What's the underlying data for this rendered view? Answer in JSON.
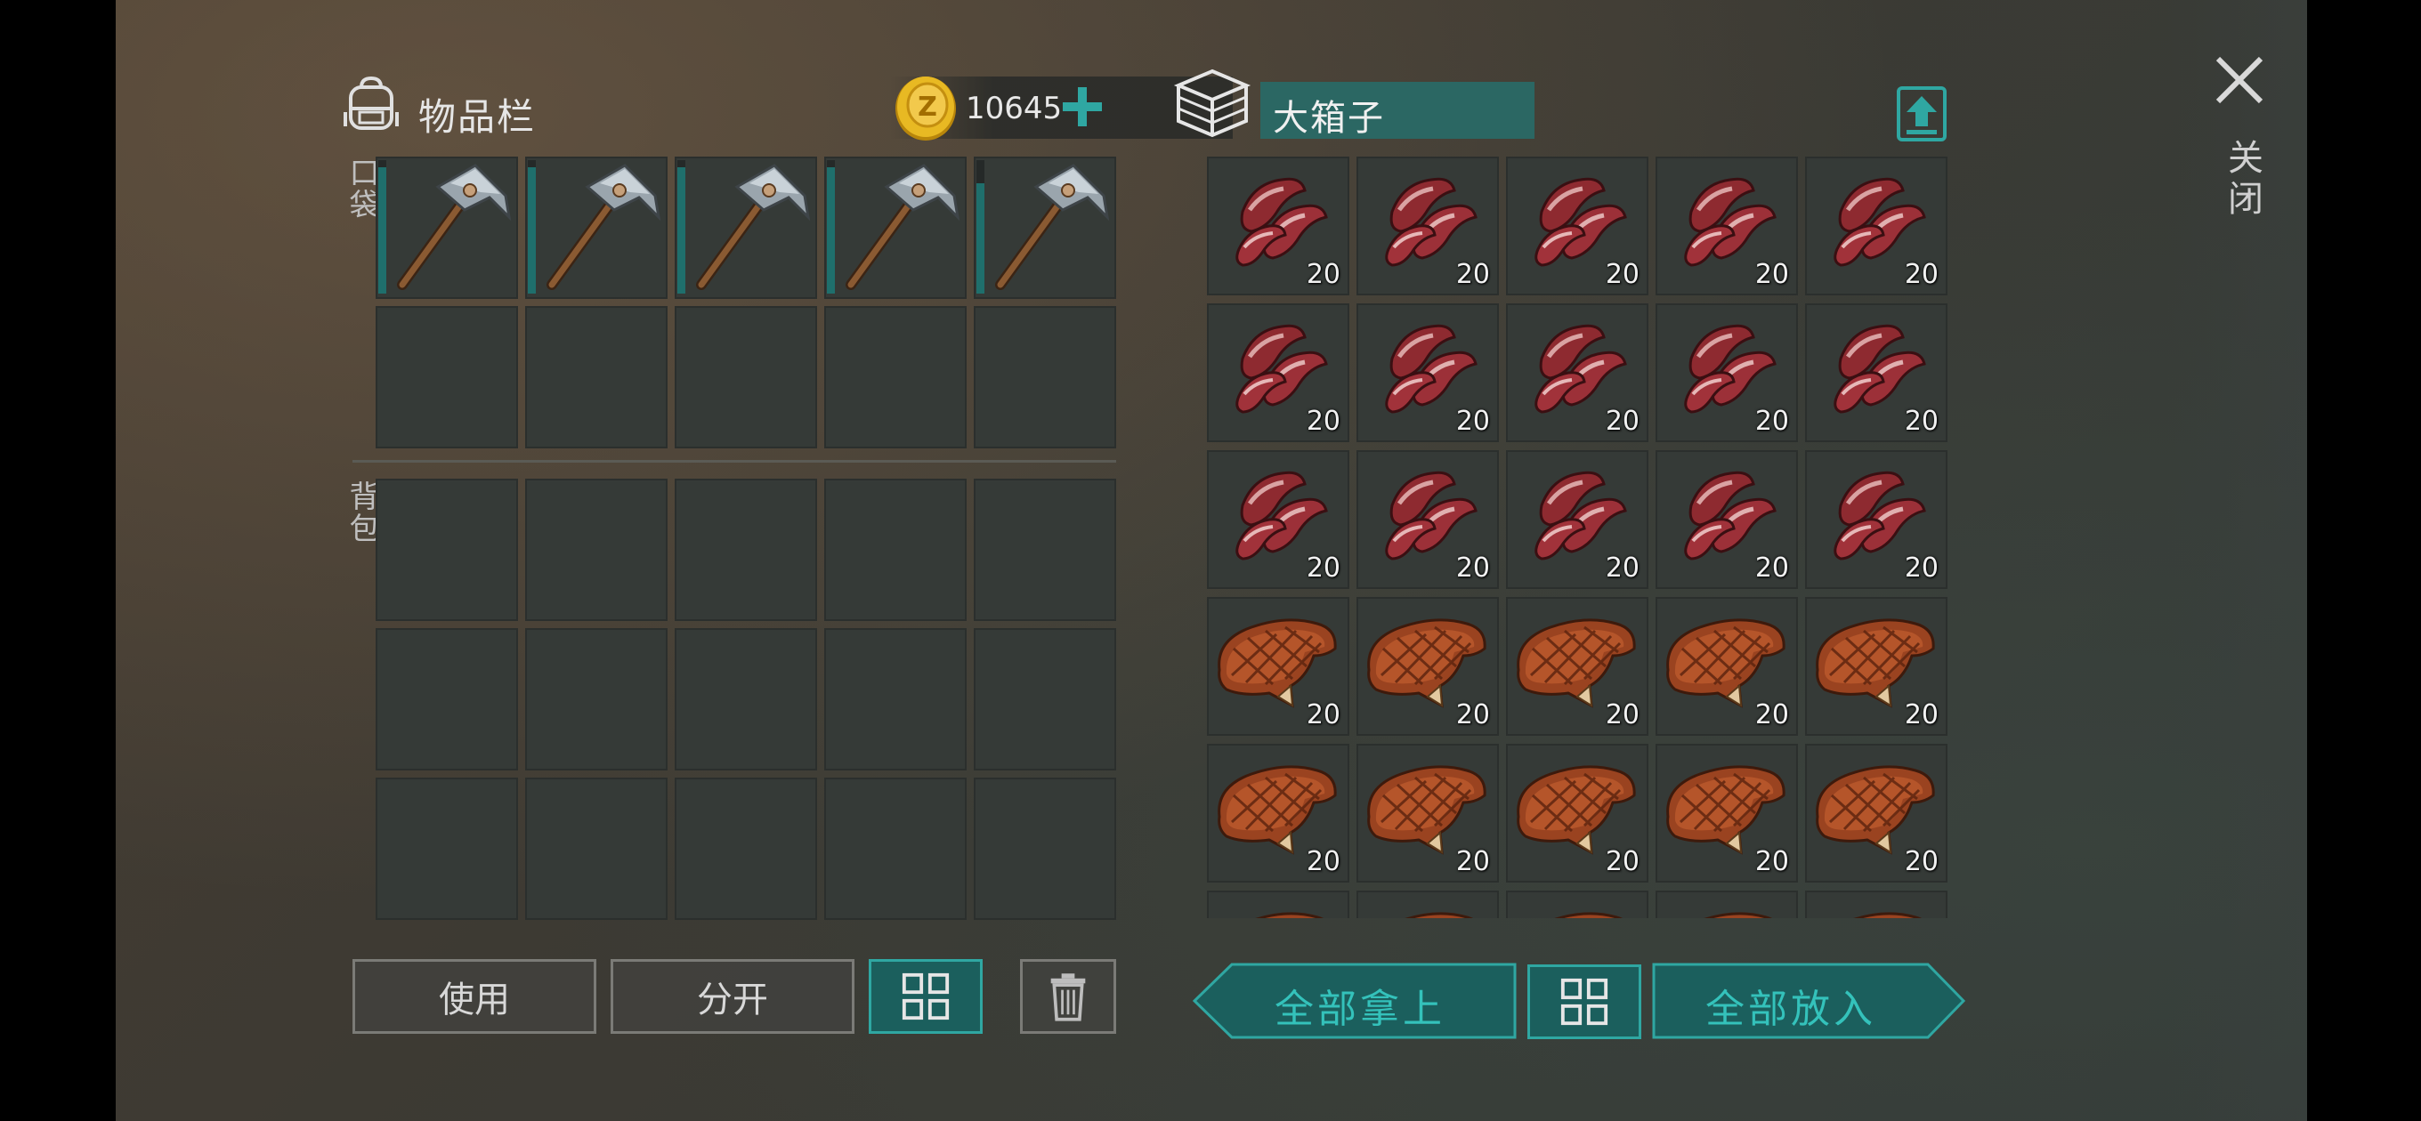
{
  "inventory": {
    "title": "物品栏",
    "coins": "10645",
    "pocket_label": "口袋",
    "backpack_label": "背包",
    "pocket_items": [
      {
        "icon": "hammer-icon",
        "durability": 0.97
      },
      {
        "icon": "hammer-icon",
        "durability": 0.97
      },
      {
        "icon": "hammer-icon",
        "durability": 0.97
      },
      {
        "icon": "hammer-icon",
        "durability": 0.97
      },
      {
        "icon": "hammer-icon",
        "durability": 0.85
      }
    ]
  },
  "container": {
    "title": "大箱子",
    "rows": [
      [
        {
          "icon": "raw-meat-icon",
          "qty": "20"
        },
        {
          "icon": "raw-meat-icon",
          "qty": "20"
        },
        {
          "icon": "raw-meat-icon",
          "qty": "20"
        },
        {
          "icon": "raw-meat-icon",
          "qty": "20"
        },
        {
          "icon": "raw-meat-icon",
          "qty": "20"
        }
      ],
      [
        {
          "icon": "raw-meat-icon",
          "qty": "20"
        },
        {
          "icon": "raw-meat-icon",
          "qty": "20"
        },
        {
          "icon": "raw-meat-icon",
          "qty": "20"
        },
        {
          "icon": "raw-meat-icon",
          "qty": "20"
        },
        {
          "icon": "raw-meat-icon",
          "qty": "20"
        }
      ],
      [
        {
          "icon": "raw-meat-icon",
          "qty": "20"
        },
        {
          "icon": "raw-meat-icon",
          "qty": "20"
        },
        {
          "icon": "raw-meat-icon",
          "qty": "20"
        },
        {
          "icon": "raw-meat-icon",
          "qty": "20"
        },
        {
          "icon": "raw-meat-icon",
          "qty": "20"
        }
      ],
      [
        {
          "icon": "steak-icon",
          "qty": "20"
        },
        {
          "icon": "steak-icon",
          "qty": "20"
        },
        {
          "icon": "steak-icon",
          "qty": "20"
        },
        {
          "icon": "steak-icon",
          "qty": "20"
        },
        {
          "icon": "steak-icon",
          "qty": "20"
        }
      ],
      [
        {
          "icon": "steak-icon",
          "qty": "20"
        },
        {
          "icon": "steak-icon",
          "qty": "20"
        },
        {
          "icon": "steak-icon",
          "qty": "20"
        },
        {
          "icon": "steak-icon",
          "qty": "20"
        },
        {
          "icon": "steak-icon",
          "qty": "20"
        }
      ],
      [
        {
          "icon": "steak-icon",
          "qty": ""
        },
        {
          "icon": "steak-icon",
          "qty": ""
        },
        {
          "icon": "steak-icon",
          "qty": ""
        },
        {
          "icon": "steak-icon",
          "qty": ""
        },
        {
          "icon": "steak-icon",
          "qty": ""
        }
      ]
    ]
  },
  "buttons": {
    "use": "使用",
    "split": "分开",
    "take_all": "全部拿上",
    "put_all": "全部放入"
  },
  "close": {
    "label": "关闭"
  },
  "colors": {
    "teal_accent": "#2fa7a2",
    "teal_fill": "#1b5f5d",
    "slot_bg": "#353a37"
  }
}
